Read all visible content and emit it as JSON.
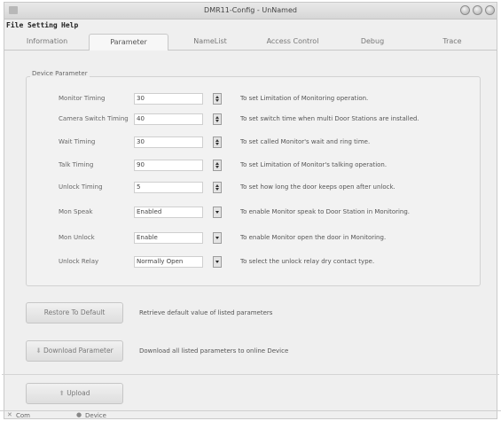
{
  "window": {
    "title": "DMR11-Config - UnNamed"
  },
  "menu": [
    "File",
    "Setting",
    "Help"
  ],
  "tabs": [
    "Information",
    "Parameter",
    "NameList",
    "Access Control",
    "Debug",
    "Trace"
  ],
  "active_tab": "Parameter",
  "group": {
    "title": "Device Parameter"
  },
  "parameters": [
    {
      "label": "Monitor Timing",
      "value": "30",
      "control": "spin",
      "description": "To set Limitation of Monitoring operation."
    },
    {
      "label": "Camera Switch Timing",
      "value": "40",
      "control": "spin",
      "description": "To set switch time when multi Door Stations are installed."
    },
    {
      "label": "Wait Timing",
      "value": "30",
      "control": "spin",
      "description": "To set called Monitor's wait and ring time."
    },
    {
      "label": "Talk Timing",
      "value": "90",
      "control": "spin",
      "description": "To set Limitation of Monitor's talking operation."
    },
    {
      "label": "Unlock Timing",
      "value": "5",
      "control": "spin",
      "description": "To set how long the door keeps open after unlock."
    },
    {
      "label": "Mon Speak",
      "value": "Enabled",
      "control": "dropdown",
      "description": "To enable Monitor speak to Door Station in Monitoring."
    },
    {
      "label": "Mon Unlock",
      "value": "Enable",
      "control": "dropdown",
      "description": "To enable Monitor open the door in Monitoring."
    },
    {
      "label": "Unlock Relay",
      "value": "Normally Open",
      "control": "dropdown",
      "description": "To select the unlock relay dry contact type."
    }
  ],
  "buttons": {
    "restore": {
      "label": "Restore To Default",
      "description": "Retrieve default value of listed parameters"
    },
    "download": {
      "label": "Download Parameter",
      "description": "Download all listed parameters to online Device"
    },
    "upload": {
      "label": "Upload"
    }
  },
  "statusbar": {
    "com": "Com",
    "device": "Device"
  }
}
